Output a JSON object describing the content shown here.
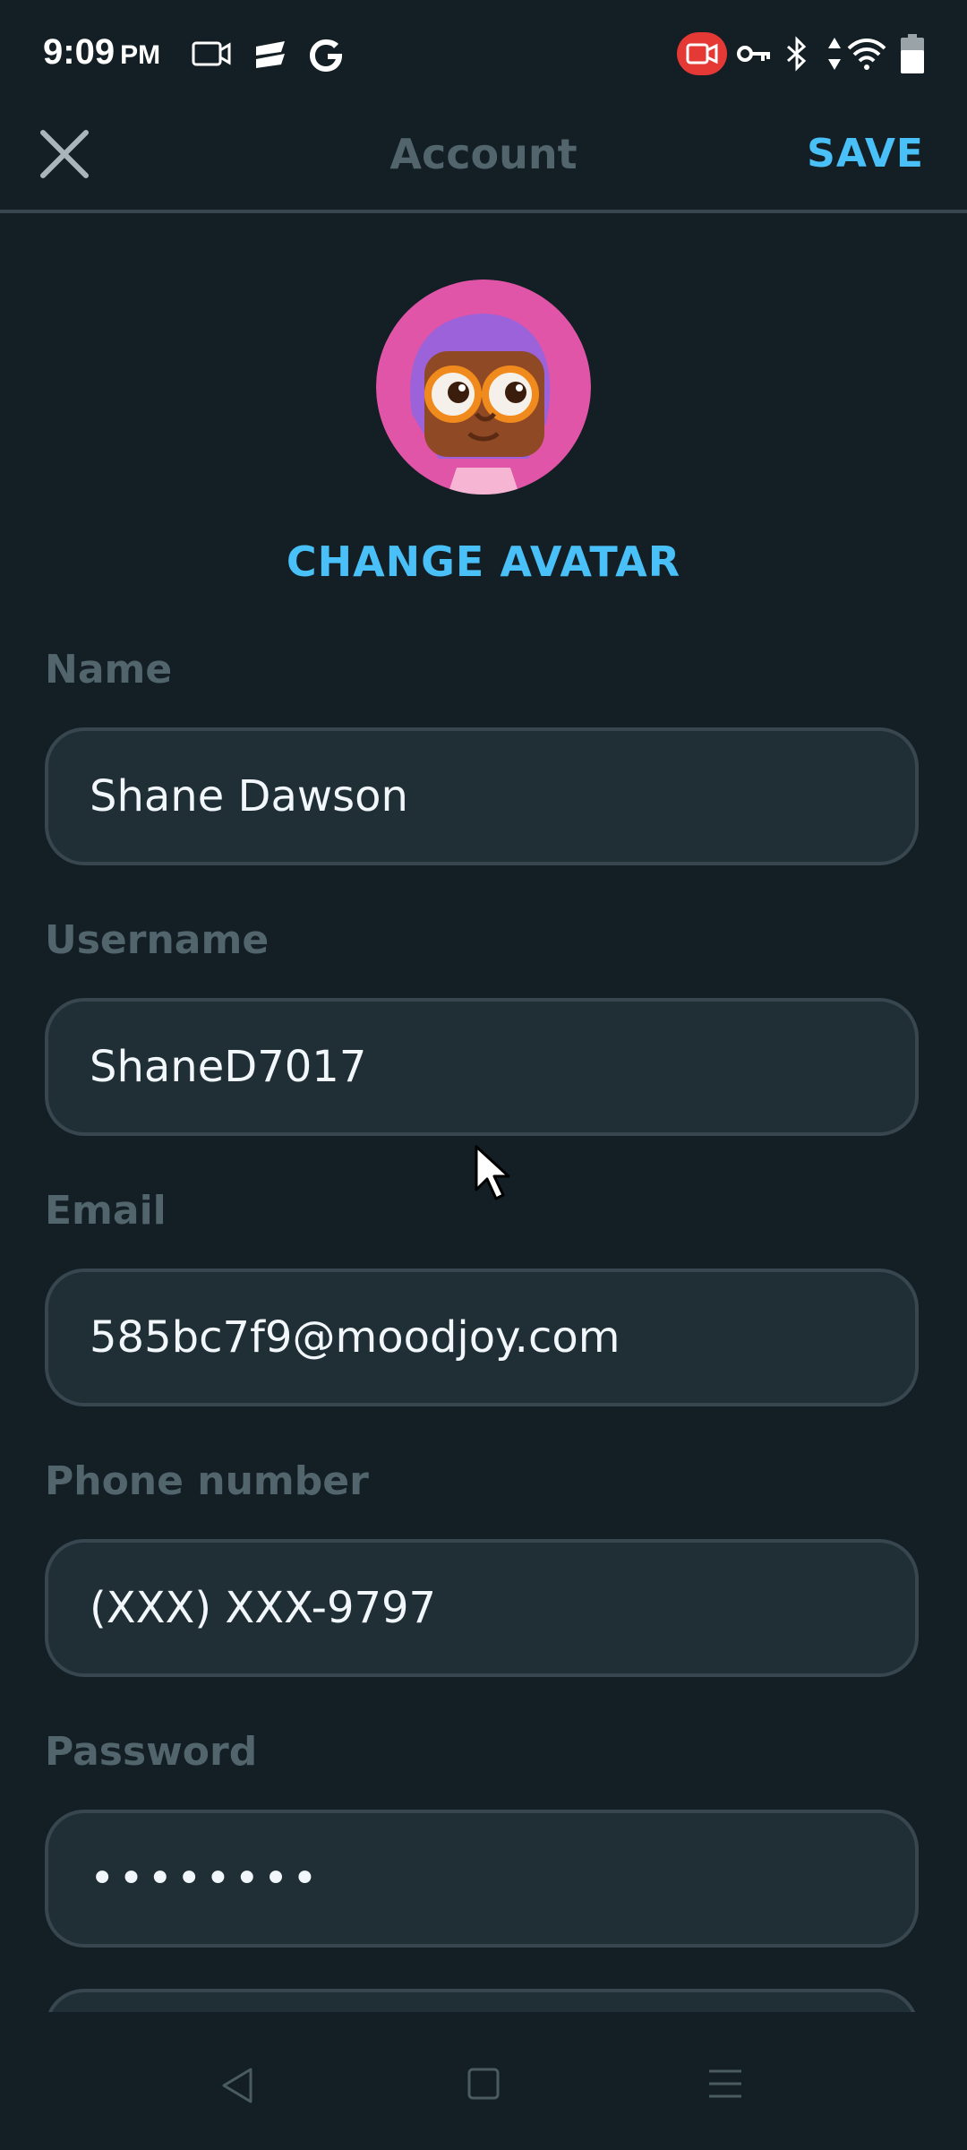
{
  "status_bar": {
    "time": "9:09",
    "ampm": "PM"
  },
  "header": {
    "title": "Account",
    "save_label": "SAVE"
  },
  "avatar": {
    "change_label": "CHANGE AVATAR"
  },
  "fields": {
    "name": {
      "label": "Name",
      "value": "Shane Dawson"
    },
    "username": {
      "label": "Username",
      "value": "ShaneD7017"
    },
    "email": {
      "label": "Email",
      "value": "585bc7f9@moodjoy.com"
    },
    "phone": {
      "label": "Phone number",
      "value": "(XXX) XXX-9797"
    },
    "password": {
      "label": "Password",
      "value": "••••••••"
    }
  },
  "colors": {
    "background": "#131f24",
    "accent": "#49c0f8",
    "label": "#52656d",
    "field_bg": "#202f36",
    "field_border": "#37464f"
  },
  "icons": {
    "close": "close-icon",
    "back": "back-icon",
    "home": "home-icon",
    "recents": "recents-icon"
  }
}
